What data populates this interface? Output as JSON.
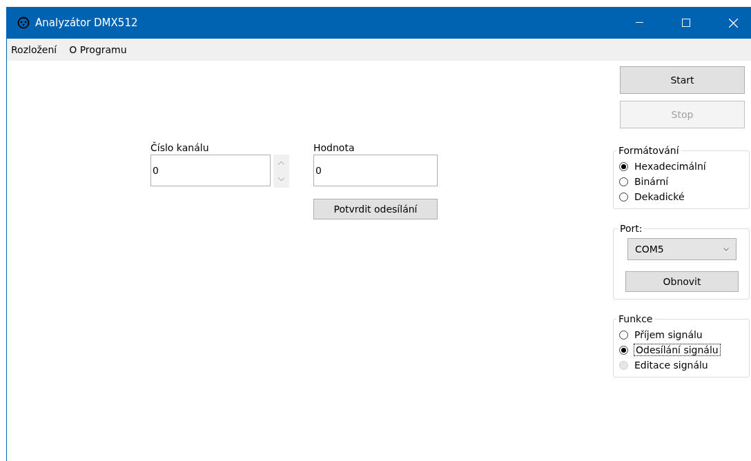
{
  "window": {
    "title": "Analyzátor DMX512"
  },
  "menu": [
    "Rozložení",
    "O Programu"
  ],
  "channel": {
    "label": "Číslo kanálu",
    "value": "0"
  },
  "value_field": {
    "label": "Hodnota",
    "value": "0"
  },
  "confirm_button": "Potvrdit odesílání",
  "start_button": {
    "label": "Start",
    "disabled": false
  },
  "stop_button": {
    "label": "Stop",
    "disabled": true
  },
  "formatting": {
    "title": "Formátování",
    "options": [
      {
        "label": "Hexadecimální",
        "selected": true,
        "disabled": false,
        "focused": false
      },
      {
        "label": "Binární",
        "selected": false,
        "disabled": false,
        "focused": false
      },
      {
        "label": "Dekadické",
        "selected": false,
        "disabled": false,
        "focused": false
      }
    ]
  },
  "port": {
    "title": "Port:",
    "value": "COM5",
    "refresh_button": "Obnovit"
  },
  "function": {
    "title": "Funkce",
    "options": [
      {
        "label": "Příjem signálu",
        "selected": false,
        "disabled": false,
        "focused": false
      },
      {
        "label": "Odesílání signálu",
        "selected": true,
        "disabled": false,
        "focused": true
      },
      {
        "label": "Editace signálu",
        "selected": false,
        "disabled": true,
        "focused": false
      }
    ]
  }
}
